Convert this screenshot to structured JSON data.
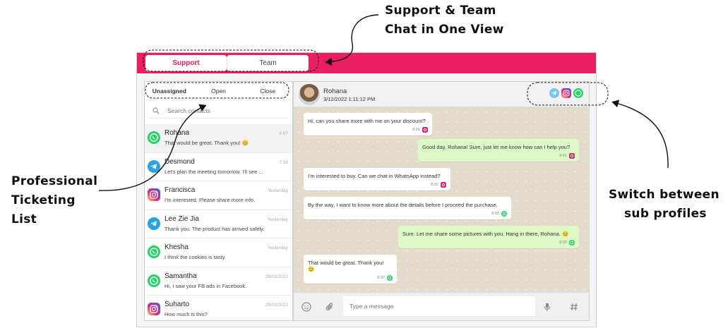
{
  "annotations": {
    "top": [
      "Support & Team",
      "Chat in One View"
    ],
    "left": [
      "Professional",
      "Ticketing List"
    ],
    "right": [
      "Switch between",
      "sub profiles"
    ]
  },
  "tabs": {
    "support": "Support",
    "team": "Team"
  },
  "filters": {
    "unassigned": "Unassigned",
    "open": "Open",
    "close": "Close"
  },
  "search": {
    "placeholder": "Search contacts"
  },
  "contacts": [
    {
      "name": "Rohana",
      "message": "That would be great. Thank you! 😊",
      "time": "8:07",
      "channel": "whatsapp"
    },
    {
      "name": "Desmond",
      "message": "Let's plan the meeting tomorrow. I'll see ...",
      "time": "7:33",
      "channel": "telegram"
    },
    {
      "name": "Francisca",
      "message": "I'm interested. Please share more info.",
      "time": "Yesterday",
      "channel": "instagram"
    },
    {
      "name": "Lee Zie Jia",
      "message": "Thank you. The product has arrived safely.",
      "time": "Yesterday",
      "channel": "telegram"
    },
    {
      "name": "Khesha",
      "message": "I think the cookies is tasty.",
      "time": "Yesterday",
      "channel": "whatsapp"
    },
    {
      "name": "Samantha",
      "message": "Hi, I saw your FB ads in Facebook.",
      "time": "29/03/2022",
      "channel": "whatsapp"
    },
    {
      "name": "Suharto",
      "message": "How much is this?",
      "time": "29/03/2022",
      "channel": "instagram"
    }
  ],
  "chat": {
    "name": "Rohana",
    "date": "3/12/2022 1:11:12 PM",
    "messages": [
      {
        "dir": "in",
        "text": "Hi, can you share more with me on your discount?",
        "time": "8:01",
        "channel": "instagram"
      },
      {
        "dir": "out",
        "text": "Good day, Rohana! Sure, just let me know how can I help you?",
        "time": "8:01",
        "channel": "instagram"
      },
      {
        "dir": "in",
        "text": "I'm interested to buy. Can we chat in WhatsApp instead?",
        "time": "8:02",
        "channel": "instagram"
      },
      {
        "dir": "in",
        "text": "By the way, I want to know more about the details before I proceed the purchase.",
        "time": "8:03",
        "channel": "whatsapp"
      },
      {
        "dir": "out",
        "text": "Sure. Let me share some pictures with you. Hang in there, Rohana. 😊",
        "time": "8:03",
        "channel": "whatsapp"
      },
      {
        "dir": "in",
        "text": "That would be great. Thank you! 😊",
        "time": "8:07",
        "channel": "whatsapp"
      }
    ]
  },
  "composer": {
    "placeholder": "Type a message"
  },
  "colors": {
    "brand": "#e91e63",
    "whatsapp": "#25d366",
    "telegram": "#2aa3e0",
    "instagram": "#d6249f"
  }
}
